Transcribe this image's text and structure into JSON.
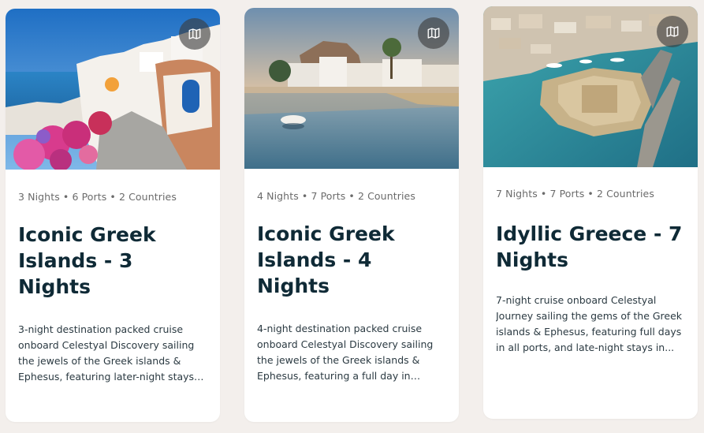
{
  "cruises": [
    {
      "meta": "3 Nights • 6 Ports • 2 Countries",
      "title": "Iconic Greek Islands - 3 Nights",
      "description": "3-night destination packed cruise onboard Celestyal Discovery sailing the jewels of the Greek islands & Ephesus, featuring later-night stays i...",
      "image": "santorini-cliffside-village",
      "icon": "map-icon"
    },
    {
      "meta": "4 Nights • 7 Ports • 2 Countries",
      "title": "Iconic Greek Islands - 4 Nights",
      "description": "4-night destination packed cruise onboard Celestyal Discovery sailing the jewels of the Greek islands & Ephesus, featuring a full day in Rhod...",
      "image": "harbor-village-at-sunset",
      "icon": "map-icon"
    },
    {
      "meta": "7 Nights • 7 Ports • 2 Countries",
      "title": "Idyllic Greece - 7 Nights",
      "description": "7-night cruise onboard Celestyal Journey sailing the gems of the Greek islands & Ephesus, featuring full days in all ports, and late-night stays in...",
      "image": "aerial-harbor-fortress",
      "icon": "map-icon"
    }
  ],
  "colors": {
    "page_background": "#f3efec",
    "card_background": "#ffffff",
    "title_text": "#0f2a36",
    "meta_text": "#6b6b6b",
    "body_text": "#2b3a42"
  }
}
